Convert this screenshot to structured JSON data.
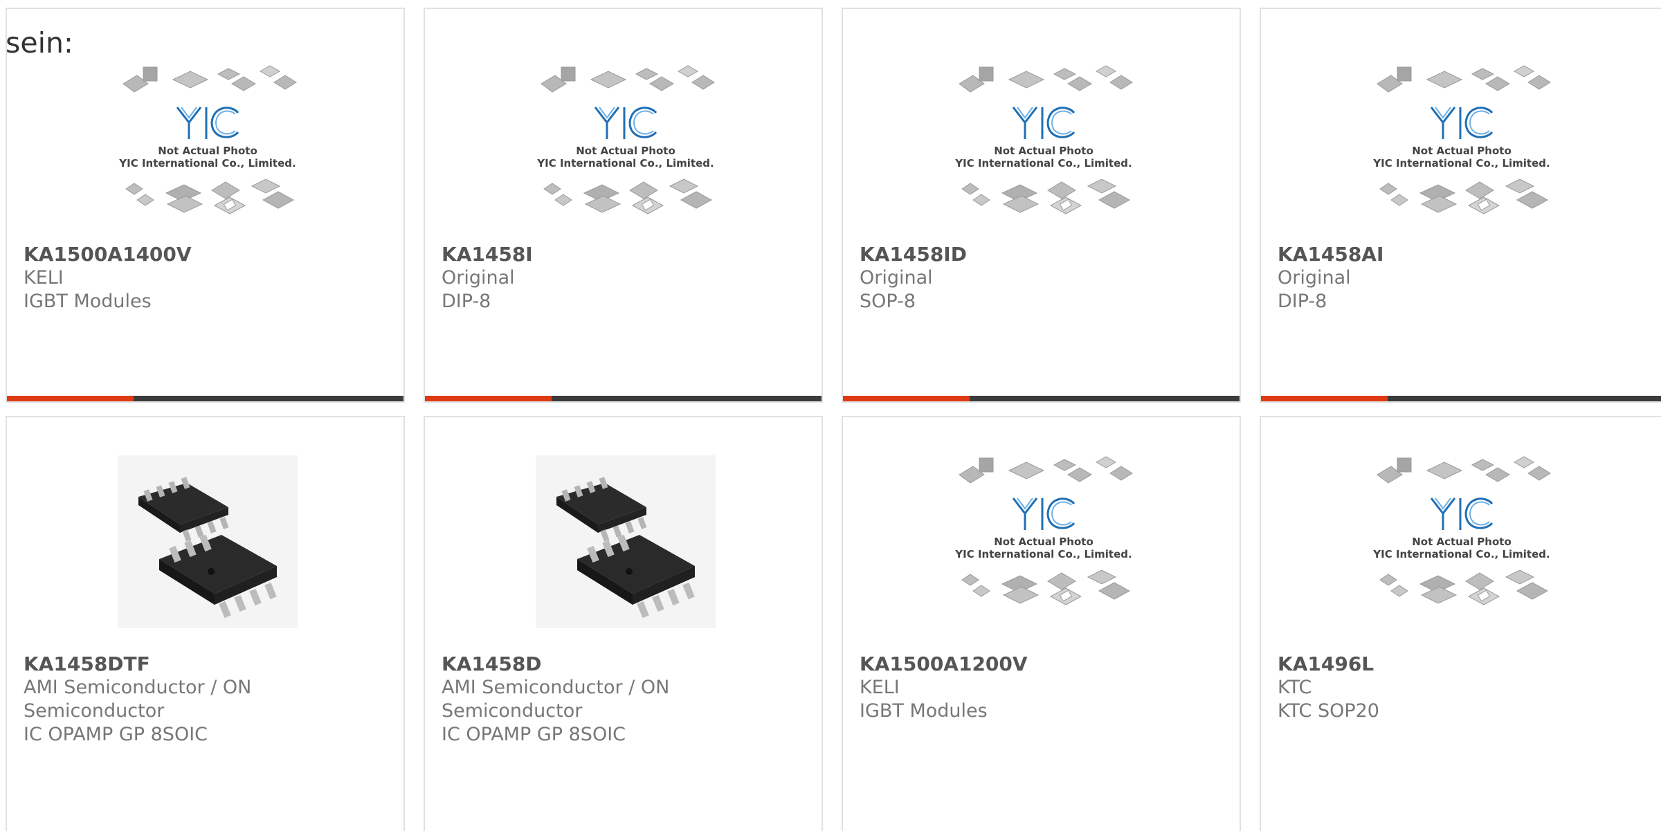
{
  "intro_text": "sein:",
  "placeholder": {
    "caption_line1": "Not Actual Photo",
    "caption_line2": "YIC International Co., Limited.",
    "logo_text": "YIC"
  },
  "products": [
    {
      "part": "KA1500A1400V",
      "line1": "KELI",
      "line2": "IGBT Modules",
      "image": "placeholder"
    },
    {
      "part": "KA1458I",
      "line1": "Original",
      "line2": "DIP-8",
      "image": "placeholder"
    },
    {
      "part": "KA1458ID",
      "line1": "Original",
      "line2": "SOP-8",
      "image": "placeholder"
    },
    {
      "part": "KA1458AI",
      "line1": "Original",
      "line2": "DIP-8",
      "image": "placeholder"
    },
    {
      "part": "KA1458DTF",
      "line1": "AMI Semiconductor / ON",
      "line2": "Semiconductor",
      "line3": "IC OPAMP GP 8SOIC",
      "image": "soic-photo"
    },
    {
      "part": "KA1458D",
      "line1": "AMI Semiconductor / ON",
      "line2": "Semiconductor",
      "line3": "IC OPAMP GP 8SOIC",
      "image": "soic-photo"
    },
    {
      "part": "KA1500A1200V",
      "line1": "KELI",
      "line2": "IGBT Modules",
      "image": "placeholder"
    },
    {
      "part": "KA1496L",
      "line1": "KTC",
      "line2": "KTC SOP20",
      "image": "placeholder"
    }
  ],
  "colors": {
    "accent": "#e03a12",
    "bar": "#3b3b3b",
    "border": "#e1e1e1",
    "logo_blue": "#1f6fb5"
  }
}
